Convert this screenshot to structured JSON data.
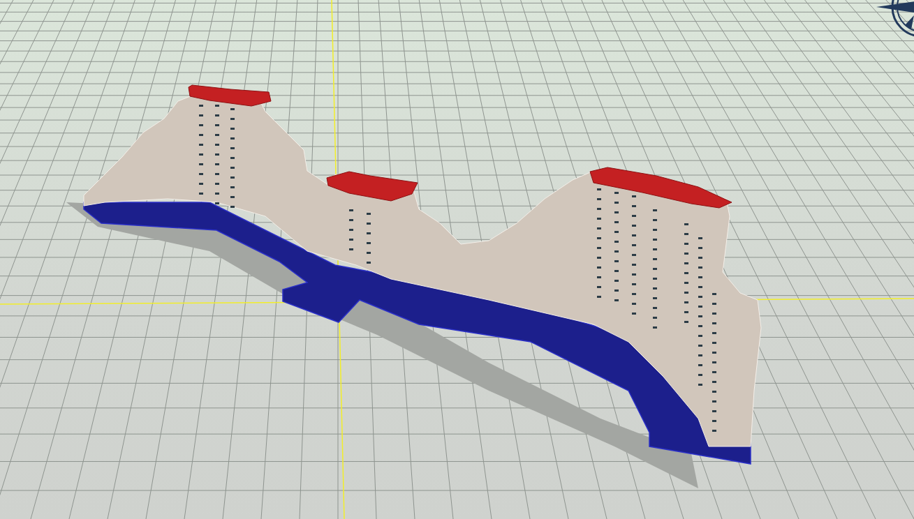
{
  "viewport": {
    "axes_visible": true,
    "compass_visible": true
  }
}
